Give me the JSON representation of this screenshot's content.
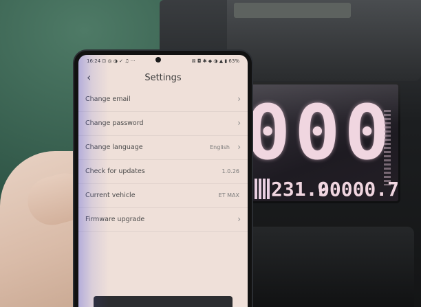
{
  "status_bar": {
    "time_left": "16:24 ⊡ ◎ ◑ ✓ ♫ ···",
    "icons_right": "⊠ ◘ ✱ ◆ ◑ ▲ ▮ 63%"
  },
  "header": {
    "title": "Settings",
    "back_icon": "chevron-left-icon"
  },
  "settings": {
    "items": [
      {
        "label": "Change email",
        "value": "",
        "chevron": true
      },
      {
        "label": "Change password",
        "value": "",
        "chevron": true
      },
      {
        "label": "Change language",
        "value": "English",
        "chevron": true
      },
      {
        "label": "Check for updates",
        "value": "1.0.26",
        "chevron": false
      },
      {
        "label": "Current vehicle",
        "value": "ET MAX",
        "chevron": false
      },
      {
        "label": "Firmware upgrade",
        "value": "",
        "chevron": true
      }
    ]
  },
  "display": {
    "speed": "000",
    "voltage": "231.9",
    "odometer": "00000.7"
  },
  "colors": {
    "screen_bg": "#efe0d9",
    "lcd_text": "#f0d6e0"
  }
}
